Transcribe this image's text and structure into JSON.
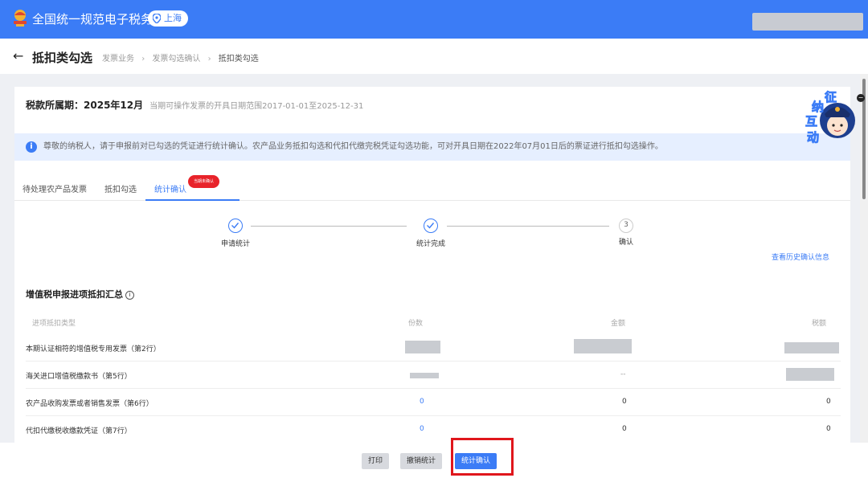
{
  "header": {
    "app_title": "全国统一规范电子税务局",
    "location": "上海",
    "colors": {
      "brand": "#3b7cf6"
    }
  },
  "breadcrumb": {
    "title": "抵扣类勾选",
    "items": [
      "发票业务",
      "发票勾选确认",
      "抵扣类勾选"
    ]
  },
  "period": {
    "label": "税款所属期：",
    "value": "2025年12月",
    "hint": "当期可操作发票的开具日期范围2017-01-01至2025-12-31"
  },
  "notice": {
    "text": "尊敬的纳税人，请于申报前对已勾选的凭证进行统计确认。农产品业务抵扣勾选和代扣代缴完税凭证勾选功能，可对开具日期在2022年07月01日后的票证进行抵扣勾选操作。"
  },
  "avatar": {
    "chars": [
      "纳",
      "征",
      "互",
      "动"
    ]
  },
  "tabs": [
    {
      "label": "待处理农产品发票",
      "active": false
    },
    {
      "label": "抵扣勾选",
      "active": false
    },
    {
      "label": "统计确认",
      "active": true
    }
  ],
  "tab_badge": "当期未确认",
  "steps": [
    {
      "label": "申请统计",
      "status": "done"
    },
    {
      "label": "统计完成",
      "status": "done"
    },
    {
      "label": "确认",
      "status": "current",
      "number": "3"
    }
  ],
  "history_link": "查看历史确认信息",
  "summary": {
    "title": "增值税申报进项抵扣汇总",
    "columns": [
      "进项抵扣类型",
      "份数",
      "金额",
      "税额"
    ],
    "rows": [
      {
        "label": "本期认证相符的增值税专用发票（第2行）",
        "count": "",
        "amount": "",
        "tax": ""
      },
      {
        "label": "海关进口增值税缴款书（第5行）",
        "count": "",
        "amount": "--",
        "tax": ""
      },
      {
        "label": "农产品收购发票或者销售发票（第6行）",
        "count": "0",
        "amount": "0",
        "tax": "0"
      },
      {
        "label": "代扣代缴税收缴款凭证（第7行）",
        "count": "0",
        "amount": "0",
        "tax": "0"
      }
    ]
  },
  "footer": {
    "print_label": "打印",
    "undo_label": "撤销统计",
    "confirm_label": "统计确认"
  }
}
